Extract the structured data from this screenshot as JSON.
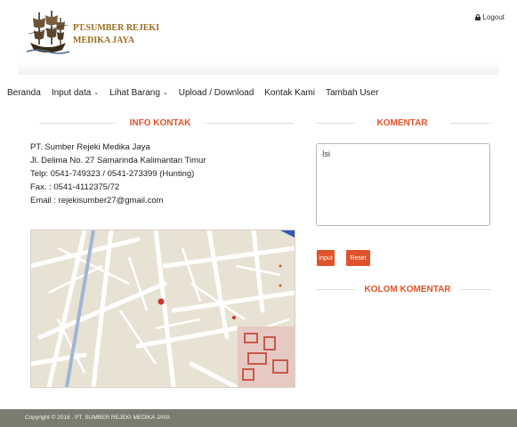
{
  "header": {
    "brand_line1": "PT.SUMBER REJEKI",
    "brand_line2": "MEDIKA JAYA",
    "logo_icon": "ship-logo-icon",
    "logout_label": "Logout",
    "logout_icon": "lock-icon"
  },
  "nav": {
    "items": [
      {
        "label": "Beranda",
        "dropdown": false
      },
      {
        "label": "Input data",
        "dropdown": true
      },
      {
        "label": "Lihat Barang",
        "dropdown": true
      },
      {
        "label": "Upload / Download",
        "dropdown": false
      },
      {
        "label": "Kontak Kami",
        "dropdown": false
      },
      {
        "label": "Tambah User",
        "dropdown": false
      }
    ],
    "chevron_glyph": "⌄"
  },
  "info_kontak": {
    "title": "INFO KONTAK",
    "lines": [
      "PT. Sumber Rejeki Medika Jaya",
      "Jl. Delima No. 27 Samarinda Kalimantan Timur",
      "Telp: 0541-749323 / 0541-273399 (Hunting)",
      "Fax. : 0541-4112375/72",
      "Email : rejekisumber27@gmail.com"
    ]
  },
  "komentar": {
    "title": "KOMENTAR",
    "textarea_value": "Isi",
    "input_label": "Input",
    "reset_label": "Reset",
    "kolom_title": "KOLOM KOMENTAR"
  },
  "footer": {
    "copyright": "Copyright © 2016 . PT. SUMBER REJEKI MEDIKA JAYA"
  },
  "colors": {
    "accent": "#e0532a",
    "brand": "#9a6b1f",
    "footer_bg": "#7b7b70"
  }
}
